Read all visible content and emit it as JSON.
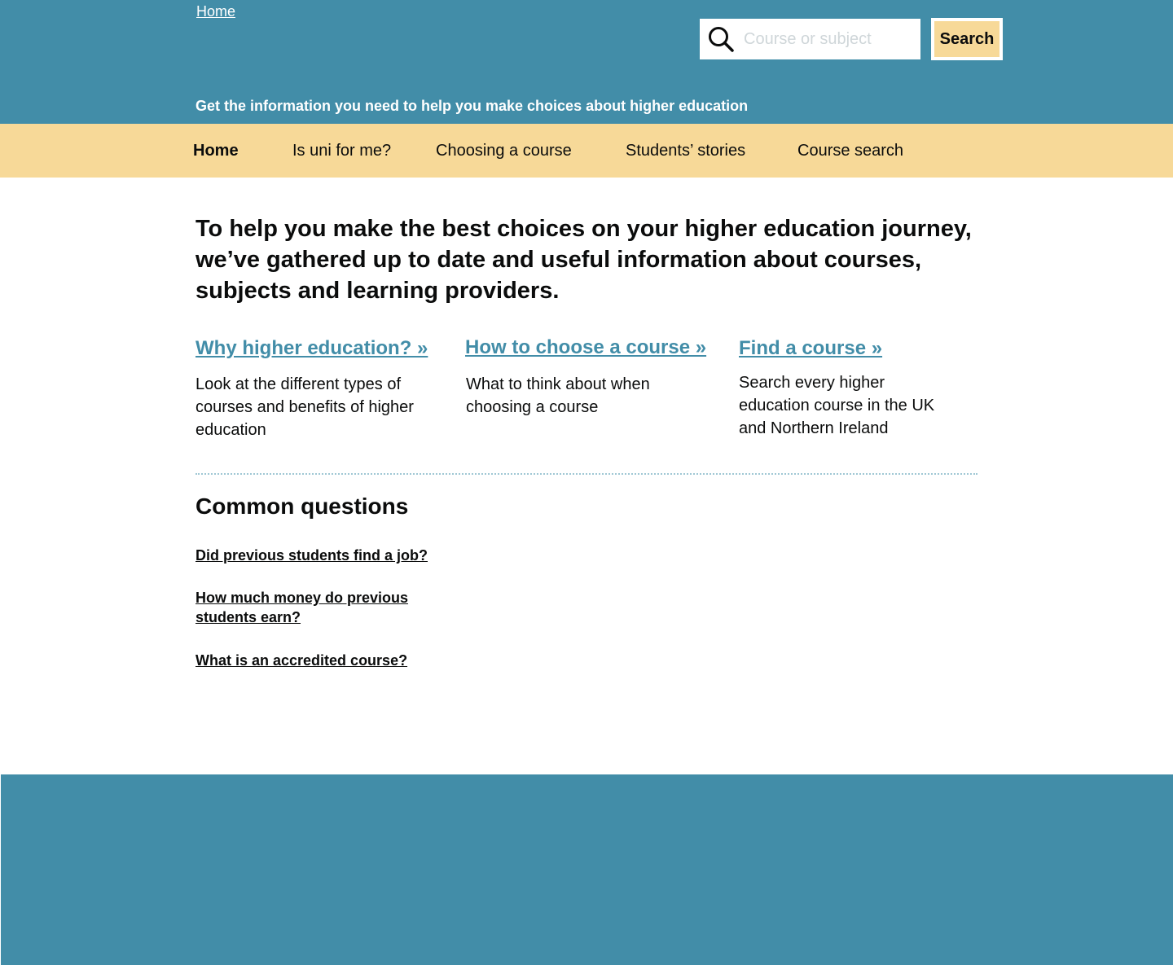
{
  "header": {
    "home_link": "Home",
    "search_placeholder": "Course or subject",
    "search_button": "Search",
    "tagline": "Get the information you need to help you make choices about higher education"
  },
  "nav": {
    "items": [
      {
        "label": "Home",
        "active": true
      },
      {
        "label": "Is uni for me?"
      },
      {
        "label": "Choosing a course"
      },
      {
        "label": "Students’ stories"
      },
      {
        "label": "Course search"
      }
    ]
  },
  "main": {
    "intro": "To help you make the best choices on your higher education journey, we’ve gathered up to date and useful information about courses, subjects and learning providers.",
    "columns": [
      {
        "link": "Why higher education? »",
        "description": "Look at the different types of courses and benefits of higher education"
      },
      {
        "link": "How to choose a course »",
        "description": "What to think about when choosing a course"
      },
      {
        "link": "Find a course »",
        "description": "Search every higher education course in the UK and Northern Ireland"
      }
    ],
    "common_questions": {
      "heading": "Common questions",
      "links": [
        "Did previous students find a job?",
        "How much money do previous students earn?",
        "What is an accredited course?"
      ]
    }
  },
  "colors": {
    "brand_teal": "#428da8",
    "accent_yellow": "#f7d998",
    "text": "#0b0c0c"
  },
  "icons": {
    "search": "search-icon"
  }
}
